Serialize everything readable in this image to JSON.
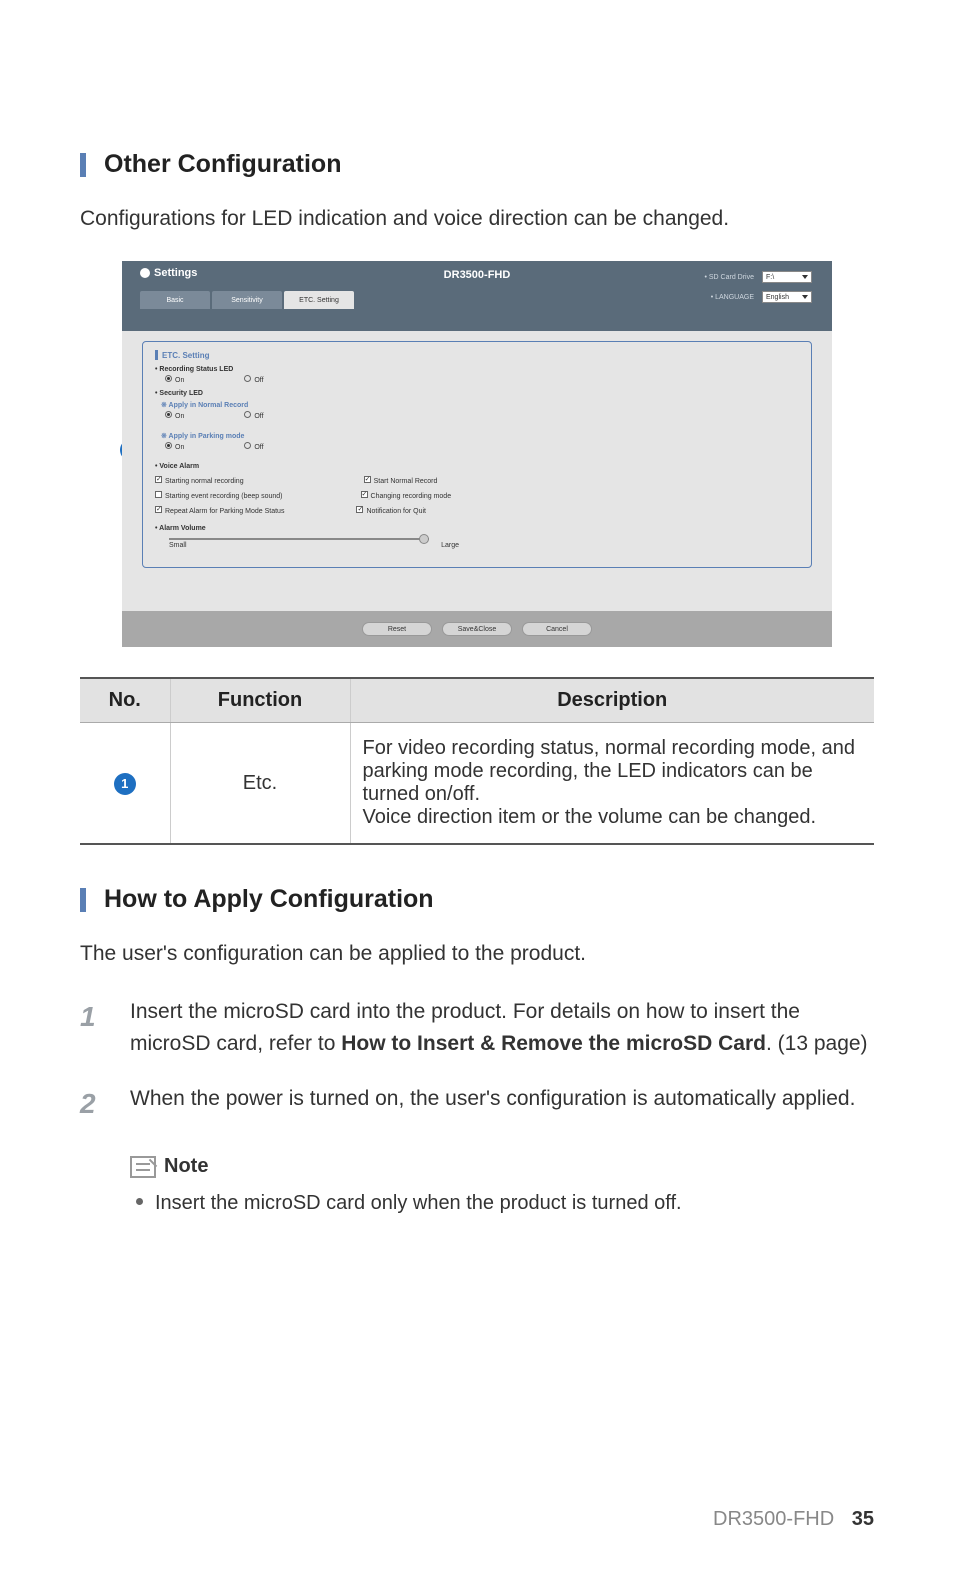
{
  "section1_title": "Other Configuration",
  "section1_intro": "Configurations for LED indication and voice direction can be changed.",
  "callout_num": "1",
  "app": {
    "title": "Settings",
    "center": "DR3500-FHD",
    "tabs": {
      "basic": "Basic",
      "sensitivity": "Sensitivity",
      "etc": "ETC. Setting"
    },
    "right": {
      "sd_label": "• SD Card Drive",
      "sd_value": "F:\\",
      "lang_label": "• LANGUAGE",
      "lang_value": "English"
    },
    "panel": {
      "title": "ETC. Setting",
      "rec_led": "• Recording Status LED",
      "sec_led": "• Security LED",
      "apply_normal": "※ Apply in Normal Record",
      "apply_parking": "※ Apply in Parking mode",
      "on": "On",
      "off": "Off",
      "voice_alarm": "• Voice Alarm",
      "va": {
        "a": "Starting normal recording",
        "b": "Start Normal Record",
        "c": "Starting event recording (beep sound)",
        "d": "Changing recording mode",
        "e": "Repeat Alarm for Parking Mode Status",
        "f": "Notification for Quit"
      },
      "alarm_vol": "• Alarm Volume",
      "small": "Small",
      "large": "Large"
    },
    "buttons": {
      "reset": "Reset",
      "save": "Save&Close",
      "cancel": "Cancel"
    }
  },
  "table": {
    "h1": "No.",
    "h2": "Function",
    "h3": "Description",
    "r1_num": "1",
    "r1_func": "Etc.",
    "r1_desc_a": "For video recording status, normal recording mode, and parking mode recording, the LED indicators can be turned on/off.",
    "r1_desc_b": "Voice direction item or the volume can be changed."
  },
  "section2_title": "How to Apply Configuration",
  "section2_intro": "The user's configuration can be applied to the product.",
  "steps": {
    "s1_num": "1",
    "s1_a": "Insert the microSD card into the product. For details on how to insert the microSD card, refer to ",
    "s1_bold": "How to Insert & Remove the microSD Card",
    "s1_b": ". (13 page)",
    "s2_num": "2",
    "s2": "When the power is turned on, the user's configuration is automatically applied."
  },
  "note_label": "Note",
  "note_text": "Insert the microSD card only when the product is turned off.",
  "footer_model": "DR3500-FHD",
  "footer_page": "35"
}
